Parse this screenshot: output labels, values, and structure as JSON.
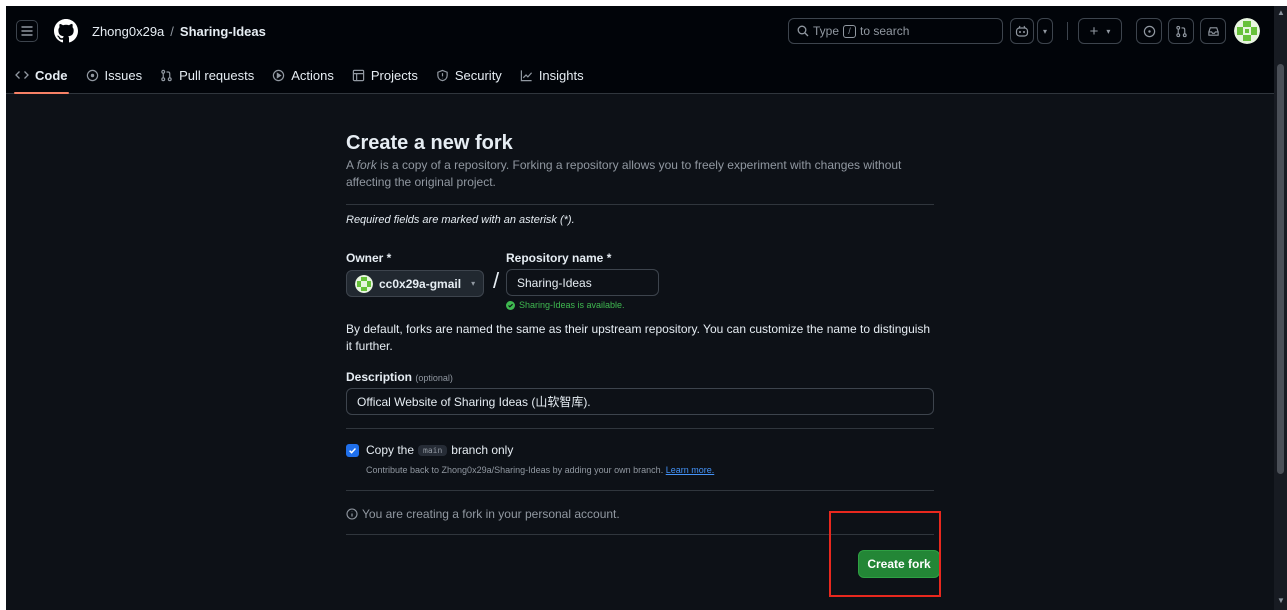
{
  "header": {
    "owner": "Zhong0x29a",
    "separator": "/",
    "repo": "Sharing-Ideas",
    "search": {
      "prefix": "Type",
      "key": "/",
      "suffix": "to search"
    }
  },
  "tabs": [
    {
      "label": "Code",
      "icon": "code-icon",
      "active": true
    },
    {
      "label": "Issues",
      "icon": "issue-icon"
    },
    {
      "label": "Pull requests",
      "icon": "pull-request-icon"
    },
    {
      "label": "Actions",
      "icon": "play-icon"
    },
    {
      "label": "Projects",
      "icon": "table-icon"
    },
    {
      "label": "Security",
      "icon": "shield-icon"
    },
    {
      "label": "Insights",
      "icon": "graph-icon"
    }
  ],
  "form": {
    "title": "Create a new fork",
    "subtitle_em": "fork",
    "subtitle_pre": "A ",
    "subtitle_rest": " is a copy of a repository. Forking a repository allows you to freely experiment with changes without affecting the original project.",
    "required_note": "Required fields are marked with an asterisk (*).",
    "owner_label": "Owner *",
    "owner_value": "cc0x29a-gmail",
    "slash": "/",
    "repo_label": "Repository name *",
    "repo_value": "Sharing-Ideas",
    "available": "Sharing-Ideas is available.",
    "help": "By default, forks are named the same as their upstream repository. You can customize the name to distinguish it further.",
    "description_label": "Description",
    "description_optional": "(optional)",
    "description_value": "Offical Website of Sharing Ideas (山软智库).",
    "copy_pre": "Copy the",
    "copy_code": "main",
    "copy_post": "branch only",
    "copy_checked": true,
    "copy_help": "Contribute back to Zhong0x29a/Sharing-Ideas by adding your own branch.",
    "learn_more": "Learn more.",
    "info": "You are creating a fork in your personal account.",
    "submit": "Create fork"
  },
  "colors": {
    "background": "#0d1117",
    "header_bg": "#010409",
    "accent_underline": "#f78166",
    "primary_button": "#238636",
    "success": "#3fb950",
    "link": "#4493f8",
    "highlight_box": "#e8281e"
  }
}
